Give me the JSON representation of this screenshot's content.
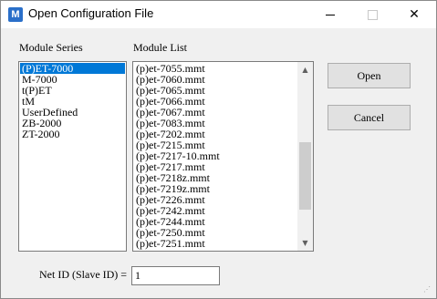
{
  "window": {
    "title": "Open Configuration File",
    "app_icon": "M"
  },
  "module_series": {
    "label": "Module Series",
    "items": [
      "(P)ET-7000",
      "M-7000",
      "t(P)ET",
      "tM",
      "UserDefined",
      "ZB-2000",
      "ZT-2000"
    ],
    "selected": "(P)ET-7000"
  },
  "module_list": {
    "label": "Module List",
    "items": [
      "(p)et-7055.mmt",
      "(p)et-7060.mmt",
      "(p)et-7065.mmt",
      "(p)et-7066.mmt",
      "(p)et-7067.mmt",
      "(p)et-7083.mmt",
      "(p)et-7202.mmt",
      "(p)et-7215.mmt",
      "(p)et-7217-10.mmt",
      "(p)et-7217.mmt",
      "(p)et-7218z.mmt",
      "(p)et-7219z.mmt",
      "(p)et-7226.mmt",
      "(p)et-7242.mmt",
      "(p)et-7244.mmt",
      "(p)et-7250.mmt",
      "(p)et-7251.mmt"
    ]
  },
  "buttons": {
    "open_label": "Open",
    "cancel_label": "Cancel"
  },
  "net_id": {
    "label": "Net ID (Slave ID) =",
    "value": "1"
  },
  "icons": {
    "app": "app-icon",
    "minimize": "minimize-icon",
    "maximize": "maximize-icon",
    "close": "close-icon",
    "scroll_up": "chevron-up-icon",
    "scroll_down": "chevron-down-icon"
  },
  "colors": {
    "selection": "#0078d7",
    "app_icon": "#2a6fc9"
  }
}
